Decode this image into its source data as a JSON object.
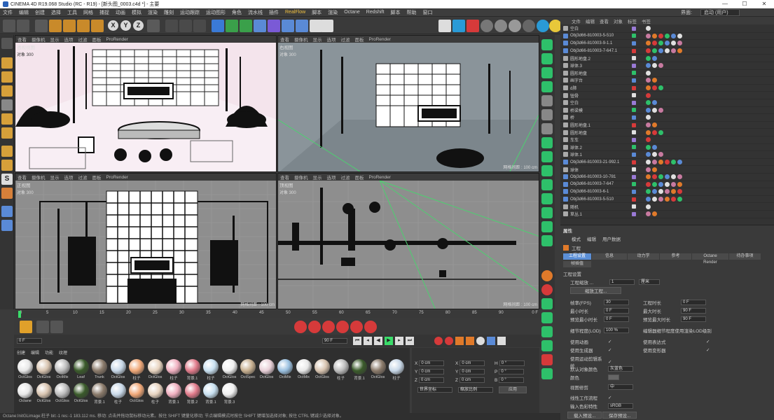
{
  "window": {
    "title": "CINEMA 4D R19.068 Studio (RC - R19) - [新头图_0003.c4d *] - 主要",
    "controls": [
      "—",
      "☐",
      "✕"
    ]
  },
  "menu": [
    "文件",
    "编辑",
    "创建",
    "选择",
    "工具",
    "网格",
    "捕捉",
    "动画",
    "模拟",
    "渲染",
    "雕刻",
    "运动跟踪",
    "运动图形",
    "角色",
    "流水线",
    "插件",
    "RealFlow",
    "脚本",
    "渲染",
    "Octane",
    "Redshift",
    "脚本",
    "帮助",
    "窗口"
  ],
  "interface": {
    "label": "界面:",
    "value": "启动 (用户)"
  },
  "viewports": [
    {
      "label": "透视视图",
      "info": "对象  300",
      "menu": [
        "查看",
        "摄像机",
        "显示",
        "选项",
        "过滤",
        "面板",
        "ProRender"
      ],
      "grid": ""
    },
    {
      "label": "右视图",
      "info": "对象  300",
      "menu": [
        "查看",
        "摄像机",
        "显示",
        "选项",
        "过滤",
        "面板",
        "ProRender"
      ],
      "grid": "网格间距 : 100 cm"
    },
    {
      "label": "正视图",
      "info": "对象  300",
      "menu": [
        "查看",
        "摄像机",
        "显示",
        "选项",
        "过滤",
        "面板",
        "ProRender"
      ],
      "grid": "网格间距 : 100 cm"
    },
    {
      "label": "顶视图",
      "info": "对象  300",
      "menu": [
        "查看",
        "摄像机",
        "显示",
        "选项",
        "过滤",
        "面板",
        "ProRender"
      ],
      "grid": "网格间距 : 100 cm"
    }
  ],
  "objects": {
    "menu": [
      "文件",
      "编辑",
      "查看",
      "对象",
      "标签",
      "书签"
    ],
    "rows": [
      "空白",
      "Obj3d66-810003-5-510",
      "Obj3d66-810003-9-1.1",
      "Obj3d66-810003-7-647.1",
      "圆形地盘.2",
      "球体.3",
      "圆形地盘",
      "画字台",
      "d肺",
      "钮骨",
      "空白",
      "桥梁模",
      "桥",
      "圆形地盘.1",
      "圆形地盘",
      "车车",
      "球体.2",
      "球体.1",
      "Obj3d66-810003-21-992.1",
      "球体",
      "Obj3d66-810003-10-781",
      "Obj3d66-810003-7-647",
      "Obj3d66-810003-6-1",
      "Obj3d66-810003-5-510",
      "随机",
      "草丛.1"
    ]
  },
  "attributes": {
    "header": "属性",
    "menu": [
      "模式",
      "编辑",
      "用户数据"
    ],
    "title": "工程",
    "tabs": [
      "工程设置",
      "信息",
      "动力学",
      "参考",
      "Octane Render",
      "待办事项"
    ],
    "subtab": "帧插值",
    "section": "工程设置",
    "scale_label": "工程缩放 ...",
    "scale_value": "1",
    "scale_unit": "厘米",
    "scale_button": "缩放工程...",
    "fps_label": "帧率(FPS)",
    "fps": "30",
    "min_label": "最小时长",
    "min": "0 F",
    "pmin_label": "预览最小时长",
    "pmin": "0 F",
    "time_label": "工程时长",
    "time": "0 F",
    "max_label": "最大时长",
    "max": "90 F",
    "pmax_label": "预览最大时长",
    "pmax": "90 F",
    "lod_label": "细节程度(LOD)",
    "lod": "100 %",
    "lod2_label": "编辑器细节程度使用渲染LOD级别",
    "anim": "使用动画",
    "expr": "使用表达式",
    "gen": "使用生成器",
    "deform": "使用变形器",
    "motion": "使用运动剪辑系统",
    "color_label": "默认对象颜色",
    "color_value": "灰蓝色",
    "color2": "颜色",
    "view_label": "视图修剪",
    "view_value": "中",
    "linear": "线性工作流程",
    "input_label": "输入色彩特性",
    "input_value": "sRGB",
    "btn1": "载入预设...",
    "btn2": "保存预设..."
  },
  "timeline": {
    "ticks": [
      "0",
      "5",
      "10",
      "15",
      "20",
      "25",
      "30",
      "35",
      "40",
      "45",
      "50",
      "55",
      "60",
      "65",
      "70",
      "75",
      "80",
      "85",
      "90"
    ],
    "end": "0 F"
  },
  "transport": {
    "start": "0 F",
    "end": "90 F",
    "current": "0 F",
    "max": "90 F"
  },
  "materials": {
    "menu": [
      "创建",
      "编辑",
      "功能",
      "纹理"
    ],
    "row1": [
      "OctGlos",
      "OctGlos",
      "OctMix",
      "Leaf",
      "Trunk",
      "OctGlos",
      "柱子",
      "OctGlos",
      "柱子",
      "背景.1",
      "柱子",
      "OctGlos",
      "OctSpec",
      "OctGlos",
      "OctMix",
      "OctMix",
      "OctGlos",
      "柱子",
      "背景.1",
      "OctGlos",
      "柱子"
    ],
    "row2": [
      "Octane",
      "OctGlos",
      "OctGlos",
      "OctGlos",
      "背景.1",
      "柱子",
      "OctGlos",
      "柱子",
      "背景.1",
      "背景.2",
      "背景.1",
      "背景.3"
    ]
  },
  "coords": {
    "x": "0 cm",
    "y": "0 cm",
    "z": "0 cm",
    "x2": "0 cm",
    "y2": "0 cm",
    "z2": "0 cm",
    "h": "0 °",
    "p": "0 °",
    "b": "0 °",
    "mode1": "世界坐标",
    "mode2": "缩放比例",
    "apply": "应用"
  },
  "status": "Octane:InitGLimage:柱子 bit:-1 res:-1 183.112 ms.      移动: 点击并拖动鼠标移动元素。按住 SHIFT 键量化移动; 节点编辑模式时按住 SHIFT 键增加选择对象; 按住 CTRL 键减少选择对象。"
}
